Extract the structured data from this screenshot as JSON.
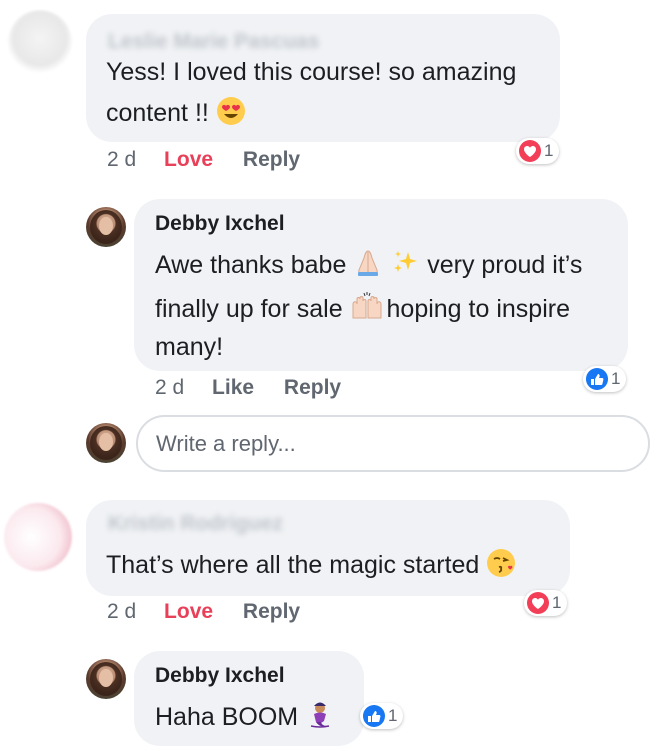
{
  "comments": [
    {
      "author": "Leslie Marie Pascuas",
      "text_line1": "Yess! I loved this course! so amazing",
      "text_line2": "content !!",
      "time": "2 d",
      "reaction_action": "Love",
      "reply_label": "Reply",
      "reaction_count": "1",
      "reaction_type": "love"
    },
    {
      "author": "Debby Ixchel",
      "text_line1a": "Awe thanks babe",
      "text_line1b": "very proud it’s",
      "text_line2a": "finally up for sale",
      "text_line2b": "hoping to inspire",
      "text_line3": "many!",
      "time": "2 d",
      "reaction_action": "Like",
      "reply_label": "Reply",
      "reaction_count": "1",
      "reaction_type": "like"
    },
    {
      "author": "Kristin Rodriguez",
      "text": "That’s where all the magic started",
      "time": "2 d",
      "reaction_action": "Love",
      "reply_label": "Reply",
      "reaction_count": "1",
      "reaction_type": "love"
    },
    {
      "author": "Debby Ixchel",
      "text": "Haha BOOM",
      "reaction_count": "1",
      "reaction_type": "like"
    }
  ],
  "reply_box": {
    "placeholder": "Write a reply..."
  },
  "colors": {
    "love": "#e9405a",
    "like": "#1877f2",
    "bubble": "#f0f2f5",
    "meta": "#606770"
  }
}
